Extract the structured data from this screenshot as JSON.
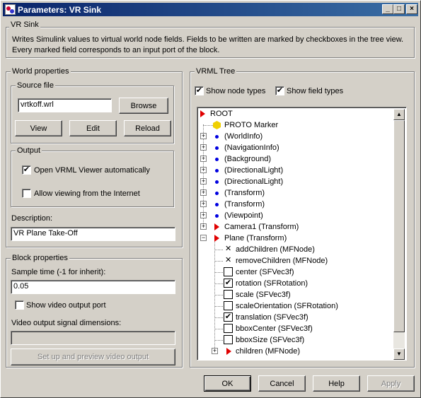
{
  "window": {
    "title": "Parameters: VR Sink"
  },
  "vr_sink": {
    "legend": "VR Sink",
    "description": "Writes Simulink values to virtual world node fields. Fields to be written are marked by checkboxes in the tree view. Every marked field corresponds to an input port of the block."
  },
  "world_properties": {
    "legend": "World properties",
    "source_file": {
      "legend": "Source file",
      "value": "vrtkoff.wrl",
      "browse": "Browse",
      "view": "View",
      "edit": "Edit",
      "reload": "Reload"
    },
    "output": {
      "legend": "Output",
      "open_viewer": {
        "label": "Open VRML Viewer automatically",
        "checked": true
      },
      "allow_internet": {
        "label": "Allow viewing from the Internet",
        "checked": false
      }
    },
    "description_label": "Description:",
    "description_value": "VR Plane Take-Off"
  },
  "block_properties": {
    "legend": "Block properties",
    "sample_time_label": "Sample time (-1 for inherit):",
    "sample_time_value": "0.05",
    "show_video": {
      "label": "Show video output port",
      "checked": false
    },
    "video_dims_label": "Video output signal dimensions:",
    "video_dims_value": "",
    "setup_button": "Set up and preview video output"
  },
  "vrml_tree": {
    "legend": "VRML Tree",
    "show_node_types": {
      "label": "Show node types",
      "checked": true
    },
    "show_field_types": {
      "label": "Show field types",
      "checked": true
    },
    "items": [
      {
        "label": "ROOT",
        "icon": "red-triangle-icon"
      },
      {
        "label": "PROTO Marker",
        "icon": "yellow-hexagon-icon"
      },
      {
        "label": "(WorldInfo)",
        "icon": "blue-dot-icon"
      },
      {
        "label": "(NavigationInfo)",
        "icon": "blue-dot-icon"
      },
      {
        "label": "(Background)",
        "icon": "blue-dot-icon"
      },
      {
        "label": "(DirectionalLight)",
        "icon": "blue-dot-icon"
      },
      {
        "label": "(DirectionalLight)",
        "icon": "blue-dot-icon"
      },
      {
        "label": "(Transform)",
        "icon": "blue-dot-icon"
      },
      {
        "label": "(Transform)",
        "icon": "blue-dot-icon"
      },
      {
        "label": "(Viewpoint)",
        "icon": "blue-dot-icon"
      },
      {
        "label": "Camera1 (Transform)",
        "icon": "red-triangle-icon"
      },
      {
        "label": "Plane (Transform)",
        "icon": "red-triangle-icon"
      },
      {
        "label": "addChildren (MFNode)",
        "icon": "x-icon"
      },
      {
        "label": "removeChildren (MFNode)",
        "icon": "x-icon"
      },
      {
        "label": "center (SFVec3f)",
        "checked": false
      },
      {
        "label": "rotation (SFRotation)",
        "checked": true
      },
      {
        "label": "scale (SFVec3f)",
        "checked": false
      },
      {
        "label": "scaleOrientation (SFRotation)",
        "checked": false
      },
      {
        "label": "translation (SFVec3f)",
        "checked": true
      },
      {
        "label": "bboxCenter (SFVec3f)",
        "checked": false
      },
      {
        "label": "bboxSize (SFVec3f)",
        "checked": false
      },
      {
        "label": "children (MFNode)",
        "icon": "red-triangle-icon"
      }
    ]
  },
  "buttons": {
    "ok": "OK",
    "cancel": "Cancel",
    "help": "Help",
    "apply": "Apply"
  },
  "marks": {
    "check": "✔",
    "x": "✕",
    "plus": "+",
    "minus": "−",
    "minimize": "_",
    "maximize": "□",
    "close": "×",
    "scroll_up": "▲",
    "scroll_down": "▼"
  }
}
